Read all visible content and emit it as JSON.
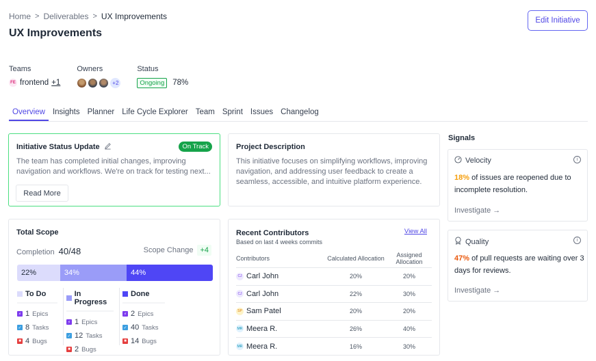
{
  "breadcrumb": [
    "Home",
    "Deliverables",
    "UX Improvements"
  ],
  "page_title": "UX Improvements",
  "edit_button": "Edit Initiative",
  "meta": {
    "teams_label": "Teams",
    "team_badge": "FE",
    "team_name": "frontend",
    "team_more": "+1",
    "owners_label": "Owners",
    "owners_more": "+2",
    "status_label": "Status",
    "status_value": "Ongoing",
    "progress": "78%"
  },
  "tabs": [
    "Overview",
    "Insights",
    "Planner",
    "Life Cycle Explorer",
    "Team",
    "Sprint",
    "Issues",
    "Changelog"
  ],
  "active_tab": "Overview",
  "status_update": {
    "title": "Initiative Status Update",
    "badge": "On Track",
    "text": "The team has completed initial changes, improving navigation and workflows. We're on track for testing next...",
    "read_more": "Read More"
  },
  "description": {
    "title": "Project Description",
    "text": "This initiative focuses on simplifying workflows, improving navigation, and addressing user feedback to create a seamless, accessible, and intuitive platform experience."
  },
  "signals": {
    "title": "Signals",
    "velocity": {
      "label": "Velocity",
      "pct": "18%",
      "text": " of issues are reopened due to incomplete resolution.",
      "link": "Investigate →"
    },
    "quality": {
      "label": "Quality",
      "pct": "47%",
      "text": " of pull requests are waiting over 3 days for reviews.",
      "link": "Investigate →"
    }
  },
  "scope": {
    "title": "Total Scope",
    "completion_label": "Completion",
    "completion_value": "40/48",
    "scope_change_label": "Scope Change",
    "scope_change_value": "+4",
    "bar": [
      {
        "label": "22%",
        "pct": 22
      },
      {
        "label": "34%",
        "pct": 34
      },
      {
        "label": "44%",
        "pct": 44
      }
    ],
    "columns": [
      {
        "title": "To Do",
        "color": "#dcdcfc",
        "epics": "1",
        "tasks": "8",
        "bugs": "4"
      },
      {
        "title": "In Progress",
        "color": "#9a9cf8",
        "epics": "1",
        "tasks": "12",
        "bugs": "2"
      },
      {
        "title": "Done",
        "color": "#4f46f5",
        "epics": "2",
        "tasks": "40",
        "bugs": "14"
      }
    ],
    "epics_label": "Epics",
    "tasks_label": "Tasks",
    "bugs_label": "Bugs"
  },
  "contributors": {
    "title": "Recent Contributors",
    "subtitle": "Based on last 4 weeks commits",
    "view_all": "View All",
    "headers": [
      "Contributors",
      "Calculated Allocation",
      "Assigned Allocation"
    ],
    "rows": [
      {
        "initials": "CJ",
        "name": "Carl John",
        "calculated": "20%",
        "assigned": "20%",
        "bg": "#ede9fe",
        "fg": "#7c3aed"
      },
      {
        "initials": "CJ",
        "name": "Carl John",
        "calculated": "22%",
        "assigned": "30%",
        "bg": "#ede9fe",
        "fg": "#7c3aed"
      },
      {
        "initials": "SP",
        "name": "Sam Patel",
        "calculated": "20%",
        "assigned": "20%",
        "bg": "#fef3c7",
        "fg": "#d97706"
      },
      {
        "initials": "MR",
        "name": "Meera R.",
        "calculated": "26%",
        "assigned": "40%",
        "bg": "#e0f2fe",
        "fg": "#0891b2"
      },
      {
        "initials": "MR",
        "name": "Meera R.",
        "calculated": "16%",
        "assigned": "30%",
        "bg": "#e0f2fe",
        "fg": "#0891b2"
      }
    ]
  }
}
